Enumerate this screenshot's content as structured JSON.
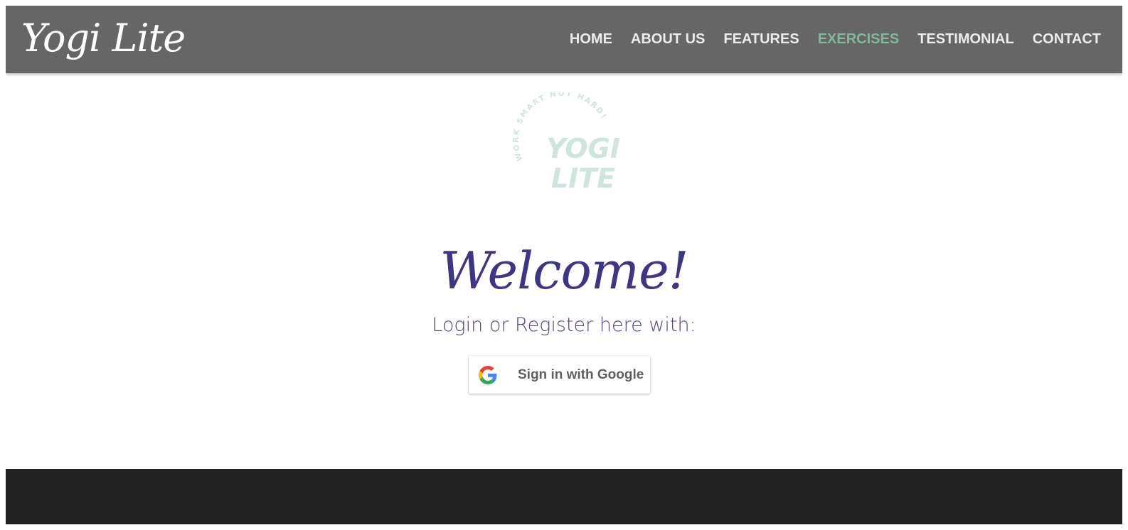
{
  "brand": {
    "name": "Yogi Lite"
  },
  "nav": {
    "items": [
      {
        "label": "HOME"
      },
      {
        "label": "ABOUT US"
      },
      {
        "label": "FEATURES"
      },
      {
        "label": "EXERCISES",
        "active": true
      },
      {
        "label": "TESTIMONIAL"
      },
      {
        "label": "CONTACT"
      }
    ]
  },
  "logo_mark": {
    "arc_text": "WORK SMART NOT HARD!",
    "line1": "YOGI",
    "line2": "LITE"
  },
  "main": {
    "heading": "Welcome!",
    "subtitle": "Login or Register here with:"
  },
  "google_button": {
    "label": "Sign in with Google"
  },
  "colors": {
    "navbar_bg": "#666666",
    "nav_text": "#ececec",
    "nav_active": "#7fb89a",
    "heading": "#3d3585",
    "subtitle": "#4b4592",
    "logo_mint": "#cfe4dc",
    "footer_bg": "#222222"
  }
}
